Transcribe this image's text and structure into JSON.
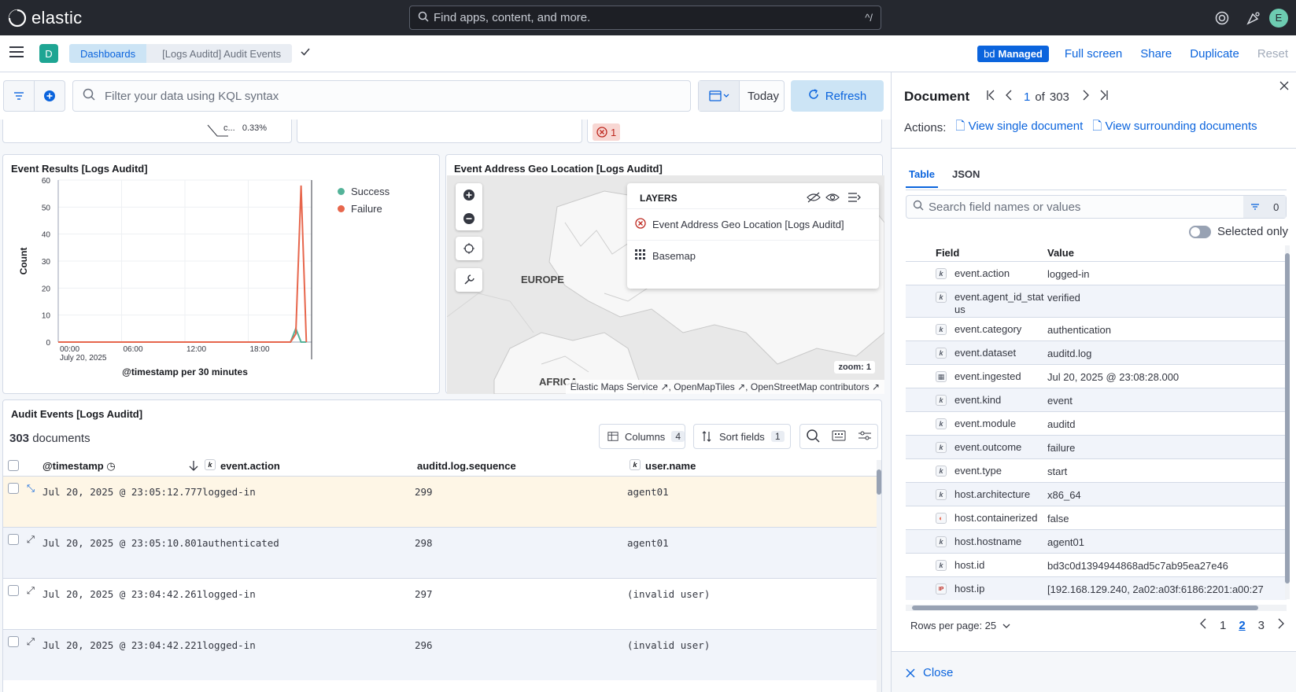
{
  "topbar": {
    "brand": "elastic",
    "search_placeholder": "Find apps, content, and more.",
    "search_shortcut": "^/",
    "avatar": "E"
  },
  "subbar": {
    "space_letter": "D",
    "breadcrumbs": [
      "Dashboards",
      "[Logs Auditd] Audit Events"
    ],
    "managed_badge": "Managed",
    "actions": [
      "Full screen",
      "Share",
      "Duplicate",
      "Reset"
    ]
  },
  "query": {
    "placeholder": "Filter your data using KQL syntax",
    "date": "Today",
    "refresh": "Refresh"
  },
  "top_partial": {
    "pie_label_a": "c...",
    "pie_value_a": "0.33%",
    "error_count": "1"
  },
  "event_results": {
    "title": "Event Results [Logs Auditd]",
    "legend": [
      "Success",
      "Failure"
    ],
    "colors": {
      "success": "#54b399",
      "failure": "#e7664c"
    },
    "ylabel": "Count",
    "xlabel": "@timestamp per 30 minutes",
    "yticks": [
      "60",
      "50",
      "40",
      "30",
      "20",
      "10",
      "0"
    ],
    "xticks": [
      "00:00",
      "06:00",
      "12:00",
      "18:00"
    ],
    "xdate": "July 20, 2025"
  },
  "chart_data": {
    "type": "line",
    "title": "Event Results [Logs Auditd]",
    "xlabel": "@timestamp per 30 minutes",
    "ylabel": "Count",
    "ylim": [
      0,
      60
    ],
    "x": [
      "00:00",
      "06:00",
      "12:00",
      "18:00",
      "22:00",
      "22:30",
      "23:00",
      "23:30"
    ],
    "series": [
      {
        "name": "Success",
        "values": [
          0,
          0,
          0,
          0,
          0,
          5,
          0,
          0
        ]
      },
      {
        "name": "Failure",
        "values": [
          0,
          0,
          0,
          0,
          0,
          3,
          58,
          0
        ]
      }
    ]
  },
  "geo": {
    "title": "Event Address Geo Location [Logs Auditd]",
    "labels": [
      "EUROPE",
      "AFRICA"
    ],
    "layers_title": "LAYERS",
    "layers": [
      "Event Address Geo Location [Logs Auditd]",
      "Basemap"
    ],
    "zoom": "zoom: 1",
    "attribution": [
      "Elastic Maps Service",
      "OpenMapTiles",
      "OpenStreetMap contributors"
    ]
  },
  "audit": {
    "title": "Audit Events [Logs Auditd]",
    "doc_count": "303",
    "doc_label": "documents",
    "columns_btn": "Columns",
    "columns_count": "4",
    "sort_btn": "Sort fields",
    "sort_count": "1",
    "headers": [
      "@timestamp",
      "event.action",
      "auditd.log.sequence",
      "user.name"
    ],
    "rows": [
      {
        "ts": "Jul 20, 2025 @ 23:05:12.777",
        "action": "logged-in",
        "seq": "299",
        "user": "agent01"
      },
      {
        "ts": "Jul 20, 2025 @ 23:05:10.801",
        "action": "authenticated",
        "seq": "298",
        "user": "agent01"
      },
      {
        "ts": "Jul 20, 2025 @ 23:04:42.261",
        "action": "logged-in",
        "seq": "297",
        "user": "(invalid user)"
      },
      {
        "ts": "Jul 20, 2025 @ 23:04:42.221",
        "action": "logged-in",
        "seq": "296",
        "user": "(invalid user)"
      }
    ]
  },
  "flyout": {
    "title": "Document",
    "page": "1",
    "of": "of",
    "total": "303",
    "actions_label": "Actions:",
    "view_single": "View single document",
    "view_surrounding": "View surrounding documents",
    "tabs": [
      "Table",
      "JSON"
    ],
    "search_placeholder": "Search field names or values",
    "filter_count": "0",
    "selected_only": "Selected only",
    "col_field": "Field",
    "col_value": "Value",
    "fields": [
      {
        "name": "event.action",
        "value": "logged-in",
        "type": "k"
      },
      {
        "name": "event.agent_id_status",
        "value": "verified",
        "type": "k"
      },
      {
        "name": "event.category",
        "value": "authentication",
        "type": "k"
      },
      {
        "name": "event.dataset",
        "value": "auditd.log",
        "type": "k"
      },
      {
        "name": "event.ingested",
        "value": "Jul 20, 2025 @ 23:08:28.000",
        "type": "date"
      },
      {
        "name": "event.kind",
        "value": "event",
        "type": "k"
      },
      {
        "name": "event.module",
        "value": "auditd",
        "type": "k"
      },
      {
        "name": "event.outcome",
        "value": "failure",
        "type": "k"
      },
      {
        "name": "event.type",
        "value": "start",
        "type": "k"
      },
      {
        "name": "host.architecture",
        "value": "x86_64",
        "type": "k"
      },
      {
        "name": "host.containerized",
        "value": "false",
        "type": "bool"
      },
      {
        "name": "host.hostname",
        "value": "agent01",
        "type": "k"
      },
      {
        "name": "host.id",
        "value": "bd3c0d1394944868ad5c7ab95ea27e46",
        "type": "k"
      },
      {
        "name": "host.ip",
        "value": "[192.168.129.240, 2a02:a03f:6186:2201:a00:27",
        "type": "ip"
      }
    ],
    "rows_per_page": "Rows per page: 25",
    "pages": [
      "1",
      "2",
      "3"
    ],
    "close": "Close"
  }
}
